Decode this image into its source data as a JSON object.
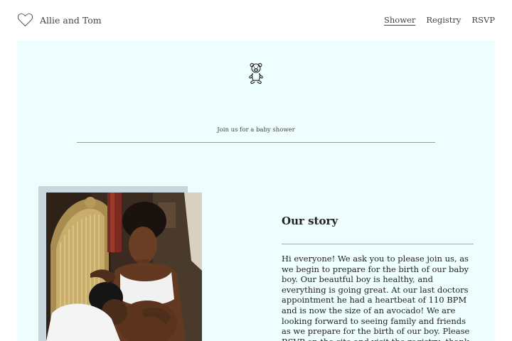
{
  "brand": {
    "name": "Allie and Tom",
    "icon": "heart-outline-icon"
  },
  "nav": {
    "items": [
      {
        "label": "Shower",
        "active": true
      },
      {
        "label": "Registry",
        "active": false
      },
      {
        "label": "RSVP",
        "active": false
      }
    ]
  },
  "hero": {
    "icon": "teddy-bear-icon",
    "tagline": "Join us for a baby shower",
    "background": "#eefdfd"
  },
  "story": {
    "title": "Our story",
    "text": "Hi everyone! We ask you to please join us, as we begin to prepare for the birth of our baby boy. Our beautful boy is healthy, and everything is going great. At our last doctors appointment he had a heartbeat of 110 BPM and is now the size of an avocado! We are looking forward to seeing family and friends as we prepare for the birth of our boy. Please RSVP on the site and visit the registry; thank you from the bottom of our hearts."
  }
}
